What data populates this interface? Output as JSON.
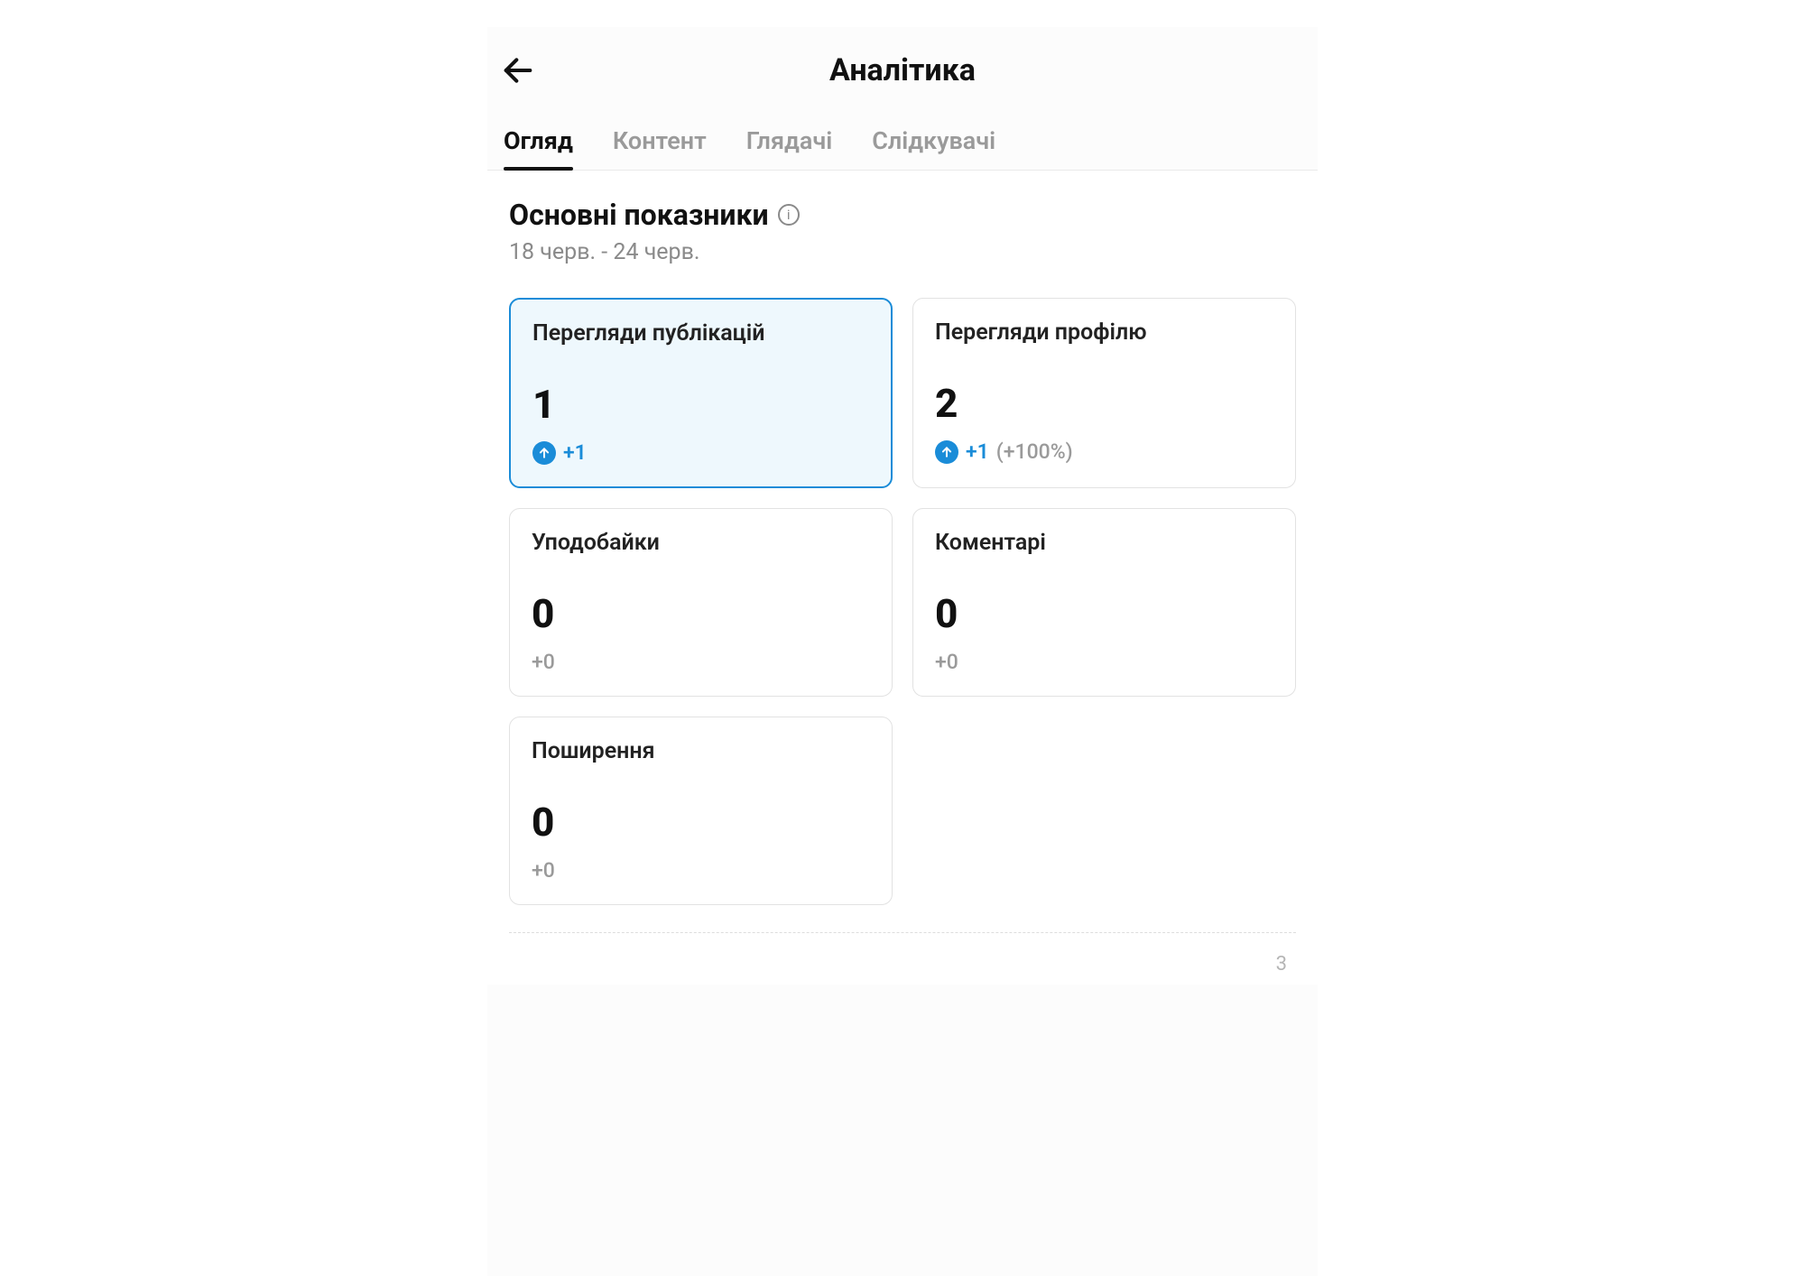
{
  "header": {
    "title": "Аналітика"
  },
  "tabs": [
    {
      "label": "Огляд",
      "active": true
    },
    {
      "label": "Контент",
      "active": false
    },
    {
      "label": "Глядачі",
      "active": false
    },
    {
      "label": "Слідкувачі",
      "active": false
    }
  ],
  "section": {
    "title": "Основні показники",
    "date_range": "18 черв. - 24 черв."
  },
  "metrics": [
    {
      "label": "Перегляди публікацій",
      "value": "1",
      "delta": "+1",
      "delta_pct": "",
      "trend": "up",
      "selected": true
    },
    {
      "label": "Перегляди профілю",
      "value": "2",
      "delta": "+1",
      "delta_pct": "(+100%)",
      "trend": "up",
      "selected": false
    },
    {
      "label": "Уподобайки",
      "value": "0",
      "delta": "+0",
      "delta_pct": "",
      "trend": "none",
      "selected": false
    },
    {
      "label": "Коментарі",
      "value": "0",
      "delta": "+0",
      "delta_pct": "",
      "trend": "none",
      "selected": false
    },
    {
      "label": "Поширення",
      "value": "0",
      "delta": "+0",
      "delta_pct": "",
      "trend": "none",
      "selected": false
    }
  ],
  "footer": {
    "page_num": "3"
  }
}
